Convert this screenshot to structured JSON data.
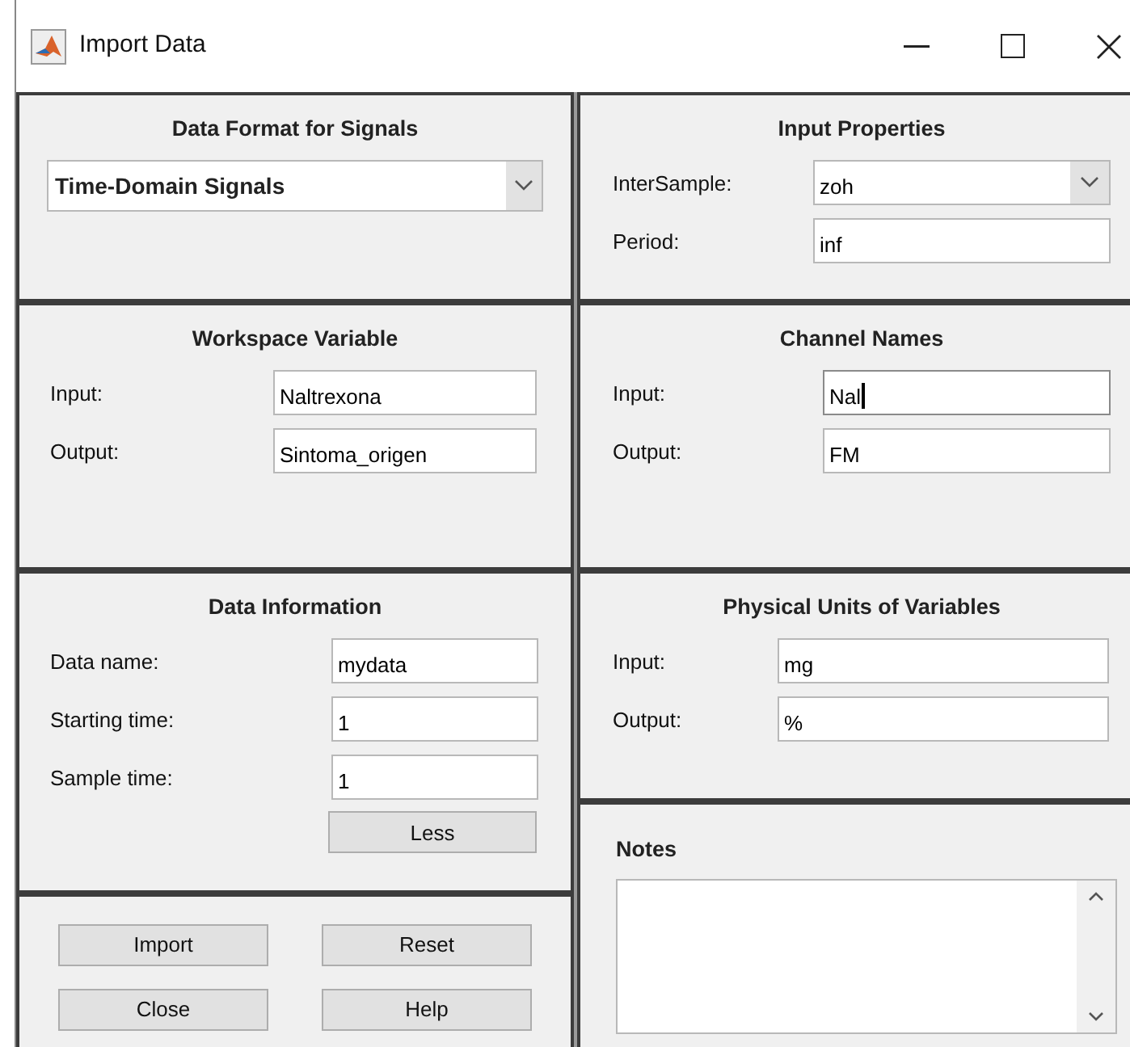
{
  "window": {
    "title": "Import Data"
  },
  "data_format": {
    "title": "Data Format for Signals",
    "dropdown": {
      "value": "Time-Domain Signals"
    }
  },
  "input_properties": {
    "title": "Input Properties",
    "fields": [
      {
        "label": "InterSample:",
        "value": "zoh",
        "kind": "dropdown"
      },
      {
        "label": "Period:",
        "value": "inf",
        "kind": "text"
      }
    ]
  },
  "workspace_variable": {
    "title": "Workspace Variable",
    "fields": [
      {
        "label": "Input:",
        "value": "Naltrexona",
        "kind": "text"
      },
      {
        "label": "Output:",
        "value": "Sintoma_origen",
        "kind": "text"
      }
    ]
  },
  "channel_names": {
    "title": "Channel Names",
    "fields": [
      {
        "label": "Input:",
        "value": "Nal",
        "kind": "text",
        "focused": true
      },
      {
        "label": "Output:",
        "value": "FM",
        "kind": "text",
        "focused": false
      }
    ]
  },
  "data_information": {
    "title": "Data Information",
    "fields": [
      {
        "label": "Data name:",
        "value": "mydata",
        "kind": "text"
      },
      {
        "label": "Starting time:",
        "value": "1",
        "kind": "text"
      },
      {
        "label": "Sample time:",
        "value": "1",
        "kind": "text"
      }
    ],
    "button": "Less"
  },
  "physical_units": {
    "title": "Physical Units of Variables",
    "fields": [
      {
        "label": "Input:",
        "value": "mg",
        "kind": "text"
      },
      {
        "label": "Output:",
        "value": "%",
        "kind": "text"
      }
    ]
  },
  "notes": {
    "title": "Notes"
  },
  "buttons": [
    "Import",
    "Reset",
    "Close",
    "Help"
  ]
}
